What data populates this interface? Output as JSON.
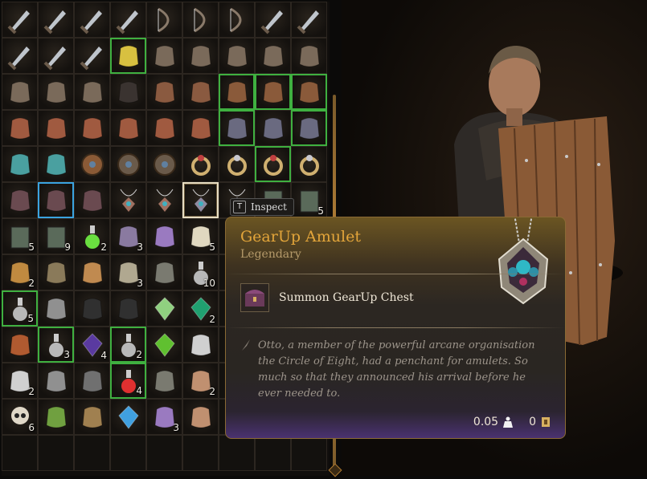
{
  "inventory": {
    "rows": [
      [
        {
          "icon": "sword"
        },
        {
          "icon": "sword"
        },
        {
          "icon": "sword"
        },
        {
          "icon": "sword"
        },
        {
          "icon": "bow"
        },
        {
          "icon": "bow"
        },
        {
          "icon": "bow"
        },
        {
          "icon": "sword"
        },
        {
          "icon": "sword"
        }
      ],
      [
        {
          "icon": "sword"
        },
        {
          "icon": "sword"
        },
        {
          "icon": "sword"
        },
        {
          "icon": "rune-sigil",
          "frame": "green"
        },
        {
          "icon": "gauntlet"
        },
        {
          "icon": "gauntlet"
        },
        {
          "icon": "gauntlet"
        },
        {
          "icon": "gauntlet"
        },
        {
          "icon": "gauntlet"
        }
      ],
      [
        {
          "icon": "gauntlet"
        },
        {
          "icon": "gauntlet"
        },
        {
          "icon": "gauntlet"
        },
        {
          "icon": "hat"
        },
        {
          "icon": "helmet"
        },
        {
          "icon": "helmet"
        },
        {
          "icon": "leather-armor",
          "frame": "green"
        },
        {
          "icon": "leather-armor",
          "frame": "green"
        },
        {
          "icon": "leather-armor",
          "frame": "green"
        }
      ],
      [
        {
          "icon": "chest-armor"
        },
        {
          "icon": "chest-armor"
        },
        {
          "icon": "chest-armor"
        },
        {
          "icon": "chest-armor"
        },
        {
          "icon": "chest-armor"
        },
        {
          "icon": "chest-armor"
        },
        {
          "icon": "scale-armor",
          "frame": "green"
        },
        {
          "icon": "scale-armor"
        },
        {
          "icon": "scale-armor",
          "frame": "green"
        }
      ],
      [
        {
          "icon": "pauldron-armor"
        },
        {
          "icon": "pauldron-armor"
        },
        {
          "icon": "wooden-shield"
        },
        {
          "icon": "round-shield"
        },
        {
          "icon": "round-shield"
        },
        {
          "icon": "ruby-ring"
        },
        {
          "icon": "silver-ring"
        },
        {
          "icon": "ruby-ring",
          "frame": "green"
        },
        {
          "icon": "silver-ring"
        }
      ],
      [
        {
          "icon": "gloves"
        },
        {
          "icon": "gloves",
          "frame": "blue"
        },
        {
          "icon": "gloves"
        },
        {
          "icon": "necklace"
        },
        {
          "icon": "necklace"
        },
        {
          "icon": "amulet",
          "frame": "selected"
        },
        {
          "icon": "amulet"
        },
        {
          "icon": "book"
        },
        {
          "icon": "book",
          "count": "5"
        }
      ],
      [
        {
          "icon": "book",
          "count": "5"
        },
        {
          "icon": "book",
          "count": "9"
        },
        {
          "icon": "vial",
          "count": "2"
        },
        {
          "icon": "herb",
          "count": "3"
        },
        {
          "icon": "lavender"
        },
        {
          "icon": "bone",
          "count": "5"
        }
      ],
      [
        {
          "icon": "jug",
          "count": "2"
        },
        {
          "icon": "shoes"
        },
        {
          "icon": "bread"
        },
        {
          "icon": "mortar",
          "count": "3"
        },
        {
          "icon": "tunic"
        },
        {
          "icon": "potion",
          "count": "10"
        }
      ],
      [
        {
          "icon": "potion",
          "count": "5",
          "frame": "green"
        },
        {
          "icon": "scroll"
        },
        {
          "icon": "ink"
        },
        {
          "icon": "ink"
        },
        {
          "icon": "green-stone"
        },
        {
          "icon": "emerald",
          "count": "2"
        }
      ],
      [
        {
          "icon": "stew"
        },
        {
          "icon": "potion",
          "count": "3",
          "frame": "green"
        },
        {
          "icon": "dark-gem",
          "count": "4"
        },
        {
          "icon": "potion",
          "count": "2",
          "frame": "green"
        },
        {
          "icon": "green-gem"
        },
        {
          "icon": "silver-plate"
        }
      ],
      [
        {
          "icon": "feather",
          "count": "2"
        },
        {
          "icon": "rock"
        },
        {
          "icon": "cloth"
        },
        {
          "icon": "red-potion",
          "count": "4",
          "frame": "green"
        },
        {
          "icon": "tunic"
        },
        {
          "icon": "root",
          "count": "2"
        }
      ],
      [
        {
          "icon": "skull",
          "count": "6"
        },
        {
          "icon": "melon"
        },
        {
          "icon": "sack"
        },
        {
          "icon": "blue-gem"
        },
        {
          "icon": "lavender",
          "count": "3"
        },
        {
          "icon": "root"
        }
      ],
      [
        {
          "icon": "empty"
        },
        {
          "icon": "empty"
        },
        {
          "icon": "empty"
        },
        {
          "icon": "empty"
        },
        {
          "icon": "empty"
        },
        {
          "icon": "empty"
        },
        {
          "icon": "empty"
        },
        {
          "icon": "empty"
        },
        {
          "icon": "empty"
        }
      ]
    ]
  },
  "inspect": {
    "key": "T",
    "label": "Inspect"
  },
  "tooltip": {
    "name": "GearUp Amulet",
    "rarity": "Legendary",
    "action": "Summon GearUp Chest",
    "description": "Otto, a member of the powerful arcane organisation the Circle of Eight, had a penchant for amulets. So much so that they announced his arrival before he ever needed to.",
    "weight": "0.05",
    "value": "0"
  },
  "colors": {
    "legendary": "#e3a53a",
    "uncommon": "#3fb040",
    "rare": "#3aa3e0"
  }
}
